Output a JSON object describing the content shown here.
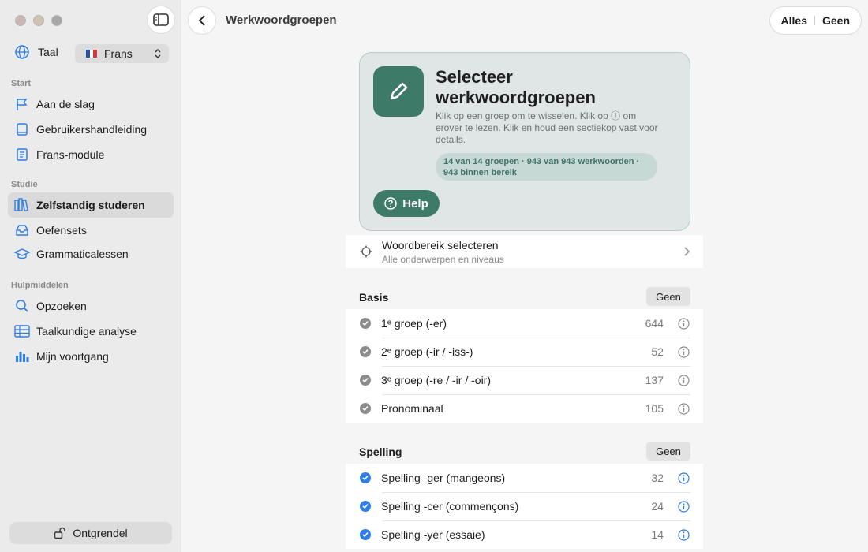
{
  "window": {
    "title": "Werkwoordgroepen"
  },
  "sidebar": {
    "language_label": "Taal",
    "language_value": "Frans",
    "sections": [
      {
        "title": "Start",
        "items": [
          {
            "label": "Aan de slag",
            "icon": "flag-icon"
          },
          {
            "label": "Gebruikershandleiding",
            "icon": "book-icon"
          },
          {
            "label": "Frans-module",
            "icon": "document-icon"
          }
        ]
      },
      {
        "title": "Studie",
        "items": [
          {
            "label": "Zelfstandig studeren",
            "icon": "books-icon",
            "active": true
          },
          {
            "label": "Oefensets",
            "icon": "tray-icon"
          },
          {
            "label": "Grammaticalessen",
            "icon": "graduation-cap-icon"
          }
        ]
      },
      {
        "title": "Hulpmiddelen",
        "items": [
          {
            "label": "Opzoeken",
            "icon": "search-icon"
          },
          {
            "label": "Taalkundige analyse",
            "icon": "table-icon"
          },
          {
            "label": "Mijn voortgang",
            "icon": "chart-icon"
          }
        ]
      }
    ],
    "unlock_label": "Ontgrendel"
  },
  "header": {
    "all_label": "Alles",
    "none_label": "Geen"
  },
  "hero": {
    "title": "Selecteer werkwoordgroepen",
    "description": "Klik op een groep om te wisselen. Klik op ⓘ om erover te lezen. Klik en houd een sectiekop vast voor details.",
    "stats": "14 van 14 groepen · 943 van 943 werkwoorden · 943 binnen bereik",
    "help_label": "Help"
  },
  "range": {
    "title": "Woordbereik selecteren",
    "subtitle": "Alle onderwerpen en niveaus"
  },
  "groups": [
    {
      "title": "Basis",
      "button": "Geen",
      "rows": [
        {
          "label": "1ᵉ groep (-er)",
          "count": "644",
          "checked": false
        },
        {
          "label": "2ᵉ groep (-ir / -iss-)",
          "count": "52",
          "checked": false
        },
        {
          "label": "3ᵉ groep (-re / -ir / -oir)",
          "count": "137",
          "checked": false
        },
        {
          "label": "Pronominaal",
          "count": "105",
          "checked": false
        }
      ]
    },
    {
      "title": "Spelling",
      "button": "Geen",
      "rows": [
        {
          "label": "Spelling -ger (mangeons)",
          "count": "32",
          "checked": true
        },
        {
          "label": "Spelling -cer (commençons)",
          "count": "24",
          "checked": true
        },
        {
          "label": "Spelling -yer (essaie)",
          "count": "14",
          "checked": true
        }
      ]
    }
  ],
  "colors": {
    "accent": "#3e7a68",
    "checked": "#2f7ee6",
    "unchecked": "#8c8c8c"
  }
}
